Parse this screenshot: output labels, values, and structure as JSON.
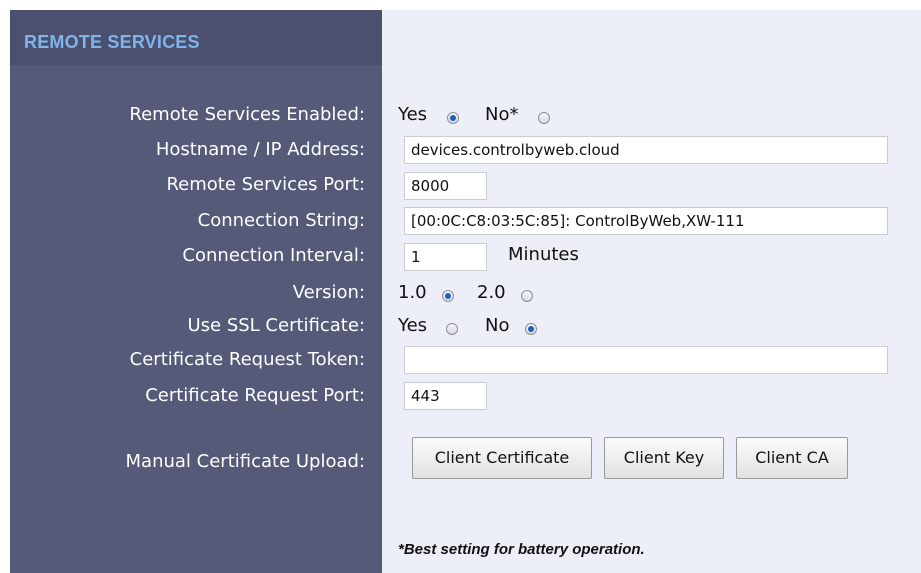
{
  "header": {
    "title": "REMOTE SERVICES"
  },
  "labels": {
    "enabled": "Remote Services Enabled:",
    "hostname": "Hostname / IP Address:",
    "port": "Remote Services Port:",
    "conn_string": "Connection String:",
    "conn_interval": "Connection Interval:",
    "version": "Version:",
    "ssl": "Use SSL Certificate:",
    "token": "Certificate Request Token:",
    "req_port": "Certificate Request Port:",
    "manual_upload": "Manual Certificate Upload:"
  },
  "fields": {
    "enabled": {
      "yes_label": "Yes",
      "no_label": "No*",
      "selected": "Yes"
    },
    "hostname": "devices.controlbyweb.cloud",
    "port": "8000",
    "conn_string": "[00:0C:C8:03:5C:85]: ControlByWeb,XW-111",
    "conn_interval": "1",
    "conn_interval_unit": "Minutes",
    "version": {
      "v1_label": "1.0",
      "v2_label": "2.0",
      "selected": "1.0"
    },
    "ssl": {
      "yes_label": "Yes",
      "no_label": "No",
      "selected": "No"
    },
    "token": "",
    "req_port": "443"
  },
  "buttons": {
    "client_certificate": "Client Certificate",
    "client_key": "Client Key",
    "client_ca": "Client CA"
  },
  "note": "*Best setting for battery operation.",
  "colors": {
    "sidebar": "#545a78",
    "header": "#4a506d",
    "header_text": "#7fb4ec",
    "content_bg": "#eceff7"
  }
}
